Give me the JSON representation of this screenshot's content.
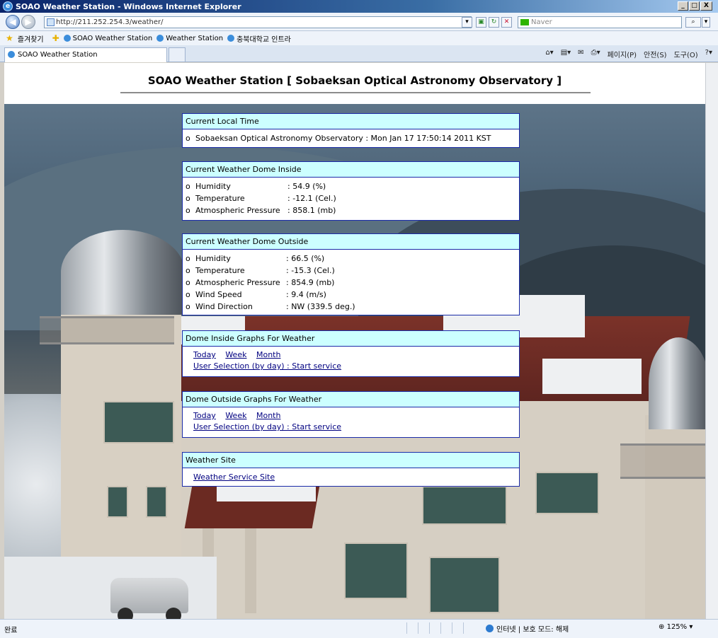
{
  "window": {
    "title": "SOAO Weather Station - Windows Internet Explorer",
    "minimize": "_",
    "maximize": "□",
    "close": "X"
  },
  "address_bar": {
    "url": "http://211.252.254.3/weather/",
    "search_placeholder": "Naver"
  },
  "favorites_bar": {
    "favorites_label": "즐겨찾기",
    "items": [
      "SOAO Weather Station",
      "Weather Station",
      "충북대학교 인트라"
    ]
  },
  "tabs": [
    {
      "label": "SOAO Weather Station"
    }
  ],
  "command_bar": {
    "page_menu": "페이지(P)",
    "safety_menu": "안전(S)",
    "tools_menu": "도구(O)"
  },
  "page": {
    "title": "SOAO Weather Station [ Sobaeksan Optical Astronomy Observatory ]",
    "panels": {
      "local_time": {
        "header": "Current Local Time",
        "bullet": "o",
        "text": "Sobaeksan Optical Astronomy Observatory : Mon Jan 17 17:50:14 2011 KST"
      },
      "dome_inside": {
        "header": "Current Weather Dome Inside",
        "rows": [
          {
            "bullet": "o",
            "label": "Humidity",
            "value": ": 54.9 (%)"
          },
          {
            "bullet": "o",
            "label": "Temperature",
            "value": ": -12.1 (Cel.)"
          },
          {
            "bullet": "o",
            "label": "Atmospheric Pressure",
            "value": ": 858.1 (mb)"
          }
        ]
      },
      "dome_outside": {
        "header": "Current Weather Dome Outside",
        "rows": [
          {
            "bullet": "o",
            "label": "Humidity",
            "value": ": 66.5 (%)"
          },
          {
            "bullet": "o",
            "label": "Temperature",
            "value": ": -15.3 (Cel.)"
          },
          {
            "bullet": "o",
            "label": "Atmospheric Pressure",
            "value": ": 854.9 (mb)"
          },
          {
            "bullet": "o",
            "label": "Wind Speed",
            "value": ": 9.4 (m/s)"
          },
          {
            "bullet": "o",
            "label": "Wind Direction",
            "value": ": NW (339.5 deg.)"
          }
        ]
      },
      "inside_graphs": {
        "header": "Dome Inside Graphs For Weather",
        "links": [
          "Today",
          "Week",
          "Month"
        ],
        "user_selection": "User Selection (by day) : Start service"
      },
      "outside_graphs": {
        "header": "Dome Outside Graphs For Weather",
        "links": [
          "Today",
          "Week",
          "Month"
        ],
        "user_selection": "User Selection (by day) : Start service"
      },
      "weather_site": {
        "header": "Weather Site",
        "link": "Weather Service Site"
      }
    }
  },
  "status_bar": {
    "left": "완료",
    "zone": "인터넷 | 보호 모드: 해제",
    "zoom": "125%"
  }
}
